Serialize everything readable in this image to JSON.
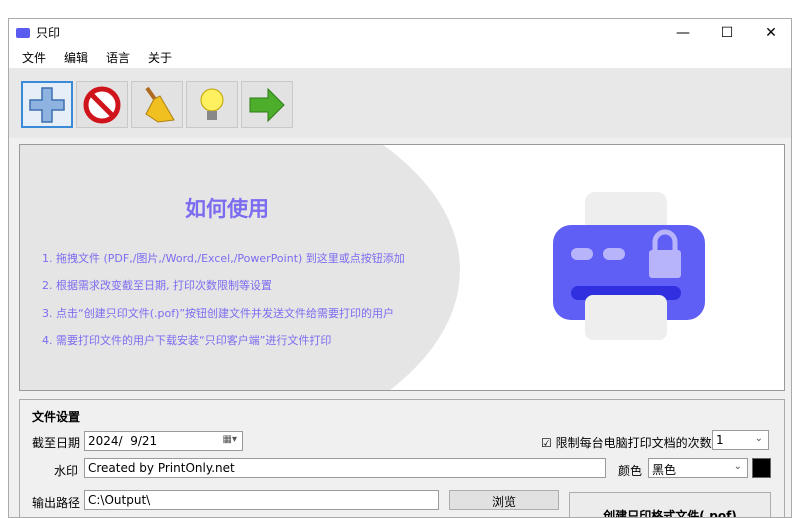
{
  "window": {
    "title": "只印",
    "minimize": "—",
    "maximize": "☐",
    "close": "✕"
  },
  "menu": [
    "文件",
    "编辑",
    "语言",
    "关于"
  ],
  "toolbar": [
    {
      "name": "add",
      "icon": "plus-icon"
    },
    {
      "name": "remove",
      "icon": "forbidden-icon"
    },
    {
      "name": "clear",
      "icon": "broom-icon"
    },
    {
      "name": "tips",
      "icon": "lightbulb-icon"
    },
    {
      "name": "next",
      "icon": "arrow-right-icon"
    }
  ],
  "howto": {
    "title": "如何使用",
    "steps": [
      "1. 拖拽文件 (PDF,/图片,/Word,/Excel,/PowerPoint) 到这里或点按钮添加",
      "2. 根据需求改变截至日期, 打印次数限制等设置",
      "3. 点击“创建只印文件(.pof)”按钮创建文件并发送文件给需要打印的用户",
      "4. 需要打印文件的用户下载安装“只印客户端”进行文件打印"
    ]
  },
  "settings": {
    "title": "文件设置",
    "date_label": "截至日期",
    "date_value": "2024/  9/21",
    "limit_label": "限制每台电脑打印文档的次数",
    "limit_checked": true,
    "limit_value": "1",
    "watermark_label": "水印",
    "watermark_value": "Created by PrintOnly.net",
    "color_label": "颜色",
    "color_value": "黑色",
    "color_swatch": "#000000",
    "output_label": "输出路径",
    "output_value": "C:\\Output\\",
    "browse": "浏览",
    "create": "创建只印格式文件(.pof)"
  },
  "colors": {
    "accent": "#7b6cf0",
    "printer": "#5b5bf0"
  }
}
